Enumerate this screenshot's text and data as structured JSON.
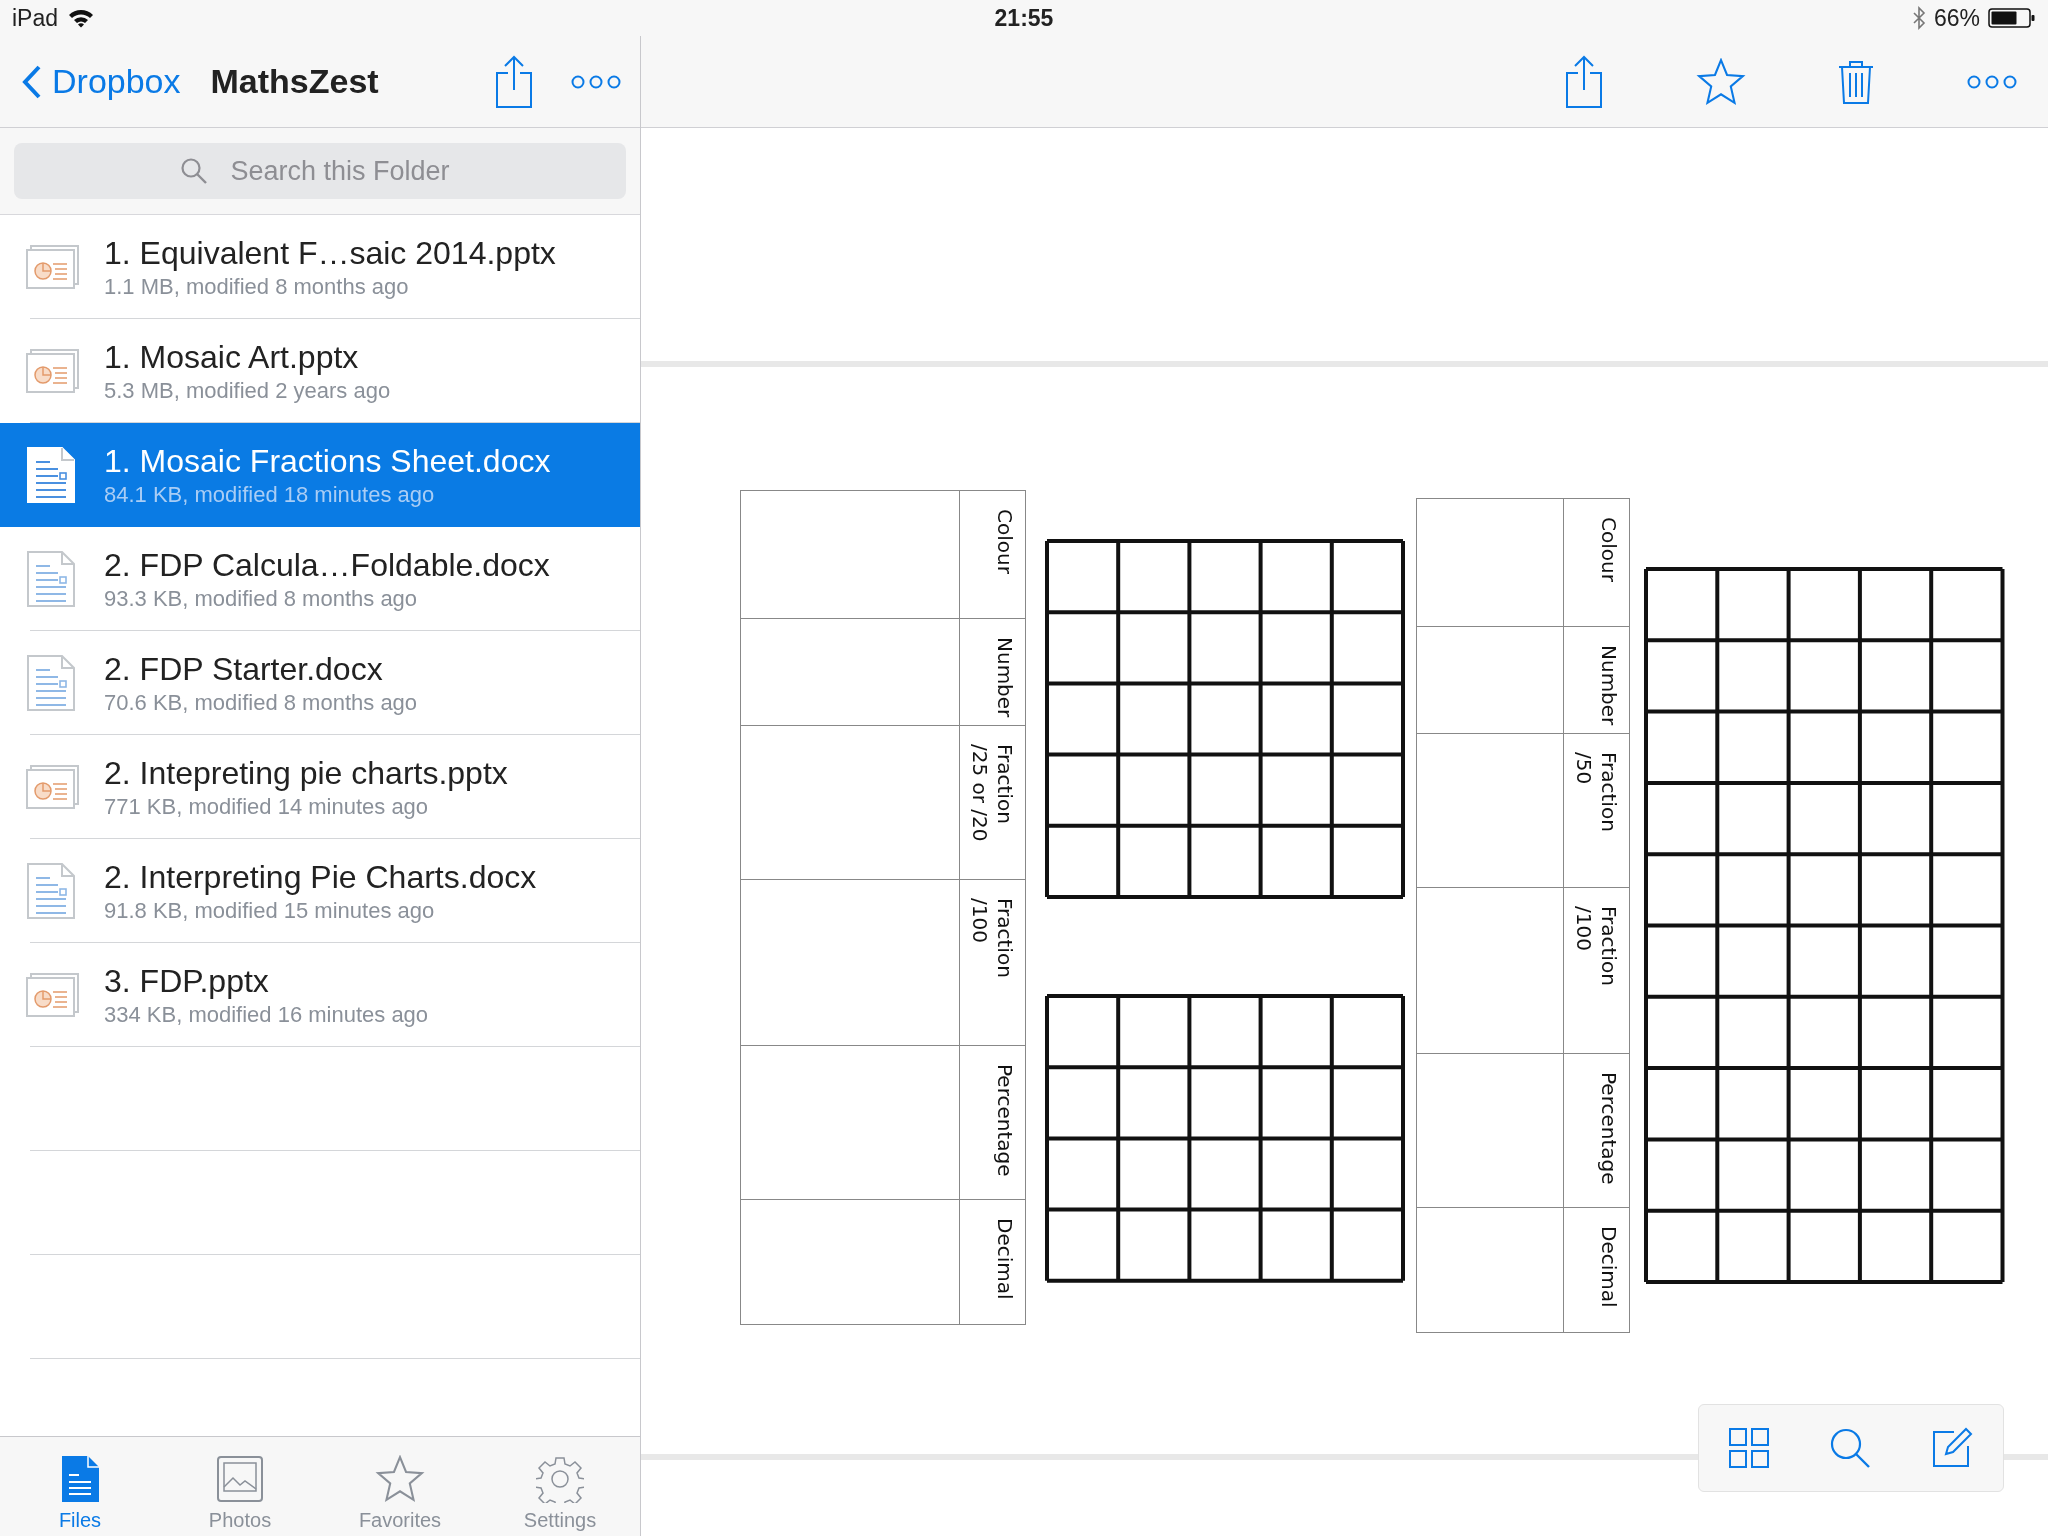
{
  "status_bar": {
    "carrier": "iPad",
    "time": "21:55",
    "battery": "66%"
  },
  "sidebar": {
    "back": "Dropbox",
    "title": "MathsZest",
    "search": {
      "placeholder": "Search this Folder"
    },
    "files": [
      {
        "name": "1. Equivalent F…saic 2014.pptx",
        "meta": "1.1 MB, modified 8 months ago",
        "kind": "pptx",
        "selected": false
      },
      {
        "name": "1. Mosaic Art.pptx",
        "meta": "5.3 MB, modified 2 years ago",
        "kind": "pptx",
        "selected": false
      },
      {
        "name": "1. Mosaic Fractions Sheet.docx",
        "meta": "84.1 KB, modified 18 minutes ago",
        "kind": "docx",
        "selected": true
      },
      {
        "name": "2. FDP Calcula…Foldable.docx",
        "meta": "93.3 KB, modified 8 months ago",
        "kind": "docx",
        "selected": false
      },
      {
        "name": "2. FDP Starter.docx",
        "meta": "70.6 KB, modified 8 months ago",
        "kind": "docx",
        "selected": false
      },
      {
        "name": "2. Intepreting pie charts.pptx",
        "meta": "771 KB, modified 14 minutes ago",
        "kind": "pptx",
        "selected": false
      },
      {
        "name": "2. Interpreting Pie Charts.docx",
        "meta": "91.8 KB, modified 15 minutes ago",
        "kind": "docx",
        "selected": false
      },
      {
        "name": "3. FDP.pptx",
        "meta": "334 KB, modified 16 minutes ago",
        "kind": "pptx",
        "selected": false
      }
    ]
  },
  "tabs": [
    {
      "label": "Files",
      "kind": "files",
      "selected": true
    },
    {
      "label": "Photos",
      "kind": "photos",
      "selected": false
    },
    {
      "label": "Favorites",
      "kind": "favorites",
      "selected": false
    },
    {
      "label": "Settings",
      "kind": "settings",
      "selected": false
    }
  ],
  "document": {
    "tables": [
      {
        "rows": [
          {
            "label": "Colour"
          },
          {
            "label": "Number"
          },
          {
            "label": "Fraction",
            "sub": "/25 or /20"
          },
          {
            "label": "Fraction",
            "sub": "/100"
          },
          {
            "label": "Percentage"
          },
          {
            "label": "Decimal"
          }
        ]
      },
      {
        "rows": [
          {
            "label": "Colour"
          },
          {
            "label": "Number"
          },
          {
            "label": "Fraction",
            "sub": "/50"
          },
          {
            "label": "Fraction",
            "sub": "/100"
          },
          {
            "label": "Percentage"
          },
          {
            "label": "Decimal"
          }
        ]
      }
    ]
  }
}
